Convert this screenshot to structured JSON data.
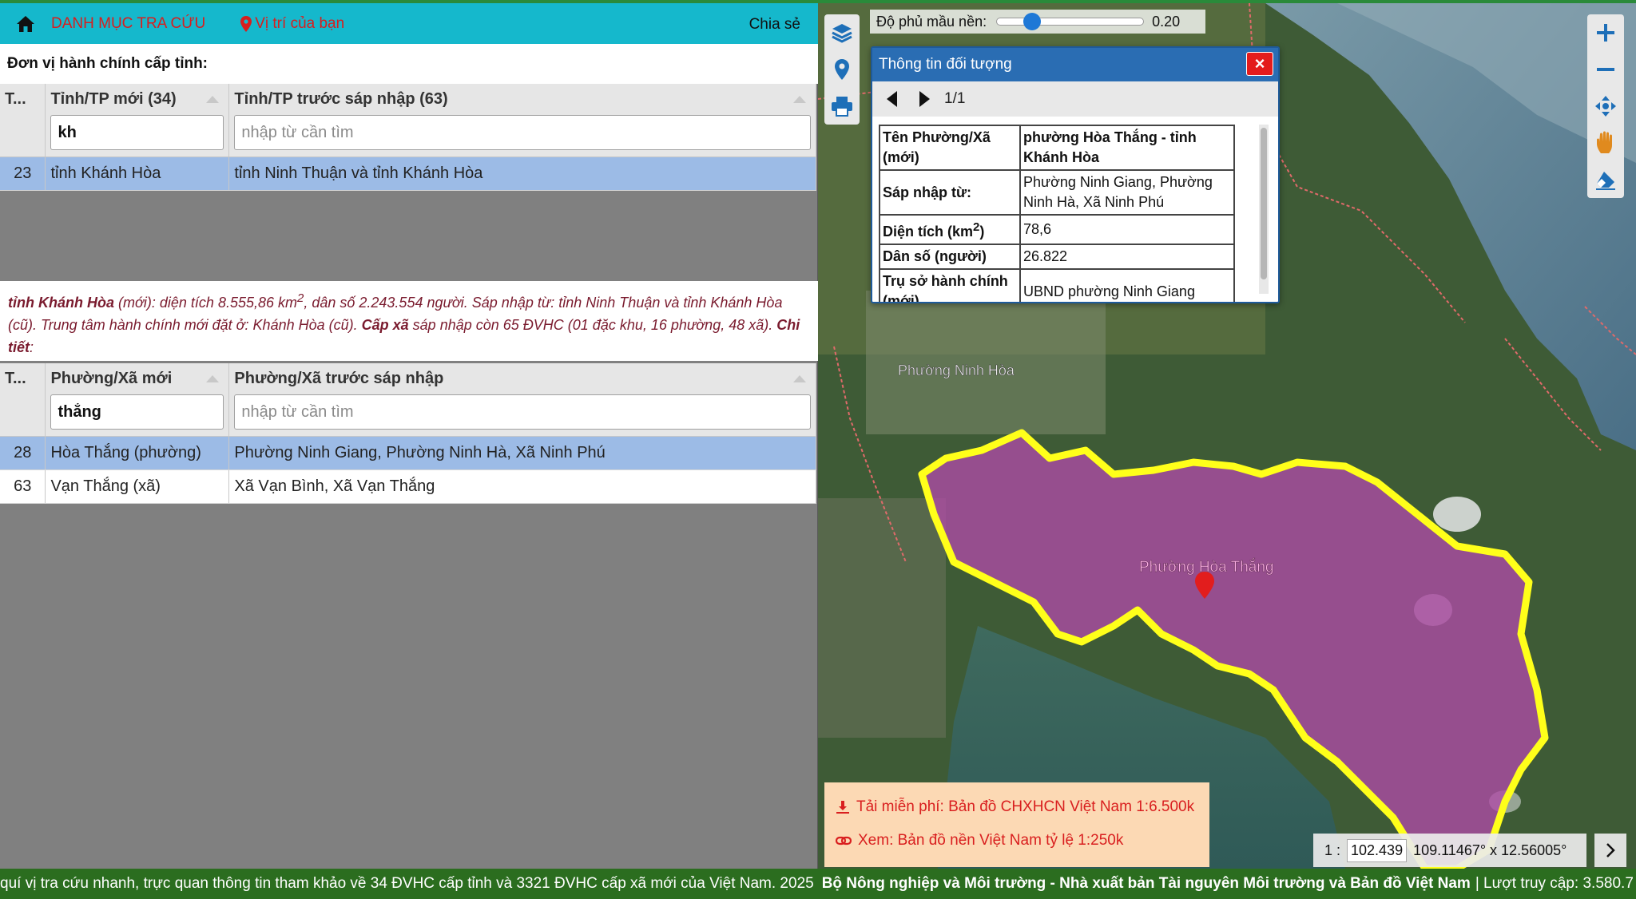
{
  "topbar": {
    "menu_label": "DANH MỤC TRA CỨU",
    "location_label": "Vị trí của bạn",
    "share_label": "Chia sẻ"
  },
  "province_section": {
    "title": "Đơn vị hành chính cấp tỉnh:",
    "columns": [
      "T...",
      "Tỉnh/TP mới (34)",
      "Tỉnh/TP trước sáp nhập (63)"
    ],
    "filter_new_value": "kh",
    "filter_old_placeholder": "nhập từ cần tìm",
    "rows": [
      {
        "no": "23",
        "new": "tỉnh Khánh Hòa",
        "old": "tỉnh Ninh Thuận và tỉnh Khánh Hòa"
      }
    ]
  },
  "province_info": {
    "name": "tỉnh Khánh Hòa",
    "suffix": "(mới)",
    "text1": ": diện tích 8.555,86 km",
    "sup": "2",
    "text2": ", dân số 2.243.554 người. Sáp nhập từ: tỉnh Ninh Thuận và tỉnh Khánh Hòa (cũ). Trung tâm hành chính mới đặt ở: Khánh Hòa (cũ). ",
    "commune_label": "Cấp xã",
    "text3": " sáp nhập còn 65 ĐVHC (01 đặc khu, 16 phường, 48 xã). ",
    "detail_label": "Chi tiết",
    "end": ":"
  },
  "commune_section": {
    "columns": [
      "T...",
      "Phường/Xã mới",
      "Phường/Xã trước sáp nhập"
    ],
    "filter_new_value": "thắng",
    "filter_old_placeholder": "nhập từ cần tìm",
    "rows": [
      {
        "no": "28",
        "new": "Hòa Thắng (phường)",
        "old": "Phường Ninh Giang, Phường Ninh Hà, Xã Ninh Phú"
      },
      {
        "no": "63",
        "new": "Vạn Thắng (xã)",
        "old": "Xã Vạn Bình, Xã Vạn Thắng"
      }
    ]
  },
  "map": {
    "opacity_label": "Độ phủ mầu nền:",
    "opacity_value": "0.20",
    "opacity_fraction": 0.2,
    "place_labels": [
      "Phường Ninh Hòa",
      "Phường Hòa Thắng"
    ],
    "highlight_color": "#b04aa6",
    "boundary_color": "#ffff1a"
  },
  "popup": {
    "title": "Thông tin đối tượng",
    "close": "×",
    "pager": "1/1",
    "rows": [
      {
        "key": "Tên Phường/Xã (mới)",
        "value": "phường Hòa Thắng - tỉnh Khánh Hòa"
      },
      {
        "key": "Sáp nhập từ:",
        "value": "Phường Ninh Giang, Phường Ninh Hà, Xã Ninh Phú"
      },
      {
        "key": "Diện tích (km",
        "key_sup": "2",
        "key_end": ")",
        "value": "78,6"
      },
      {
        "key": "Dân số (người)",
        "value": "26.822"
      },
      {
        "key": "Trụ sở hành chính (mới)",
        "value": "UBND phường Ninh Giang"
      }
    ]
  },
  "promo": {
    "download": "Tải miễn phí: Bản đồ CHXHCN Việt Nam 1:6.500k",
    "view": "Xem: Bản đồ nền Việt Nam tỷ lệ 1:250k"
  },
  "scale": {
    "prefix": "1 :",
    "value": "102.439",
    "coords": "109.11467° x 12.56005°"
  },
  "footer": {
    "text": "quí vị tra cứu nhanh, trực quan thông tin tham khảo về 34 ĐVHC cấp tỉnh và 3321 ĐVHC cấp xã mới của Việt Nam. 2025",
    "bold": "Bộ Nông nghiệp và Môi trường - Nhà xuất bản Tài nguyên Môi trường và Bản đồ Việt Nam",
    "counter": "| Lượt truy cập: 3.580.7"
  }
}
